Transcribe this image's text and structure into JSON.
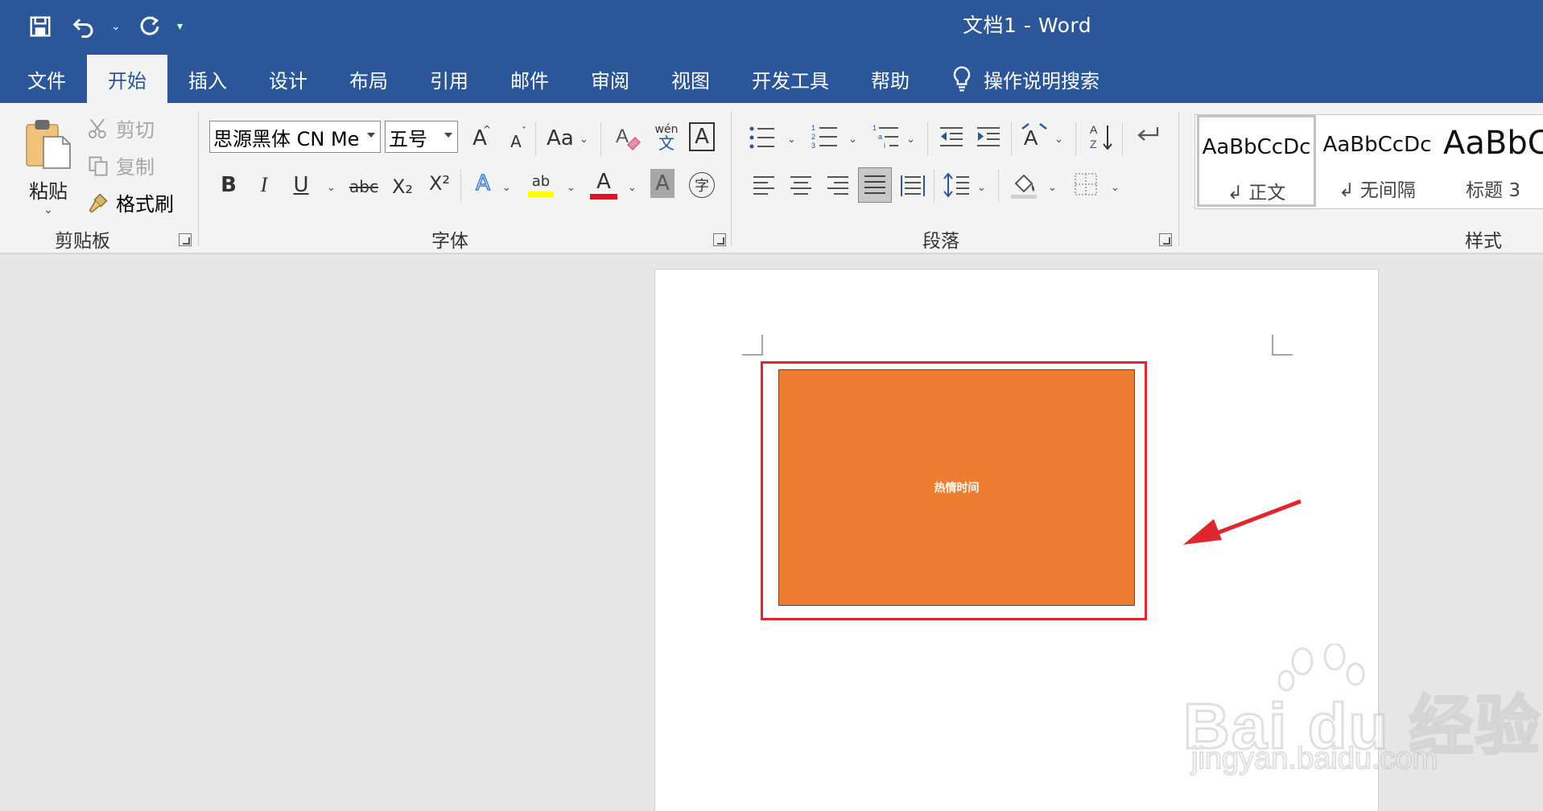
{
  "window": {
    "title": "文档1  -  Word"
  },
  "quick_access": {
    "icons": [
      "save-icon",
      "undo-icon",
      "redo-icon",
      "customize-icon"
    ]
  },
  "tabs": [
    {
      "label": "文件"
    },
    {
      "label": "开始",
      "active": true
    },
    {
      "label": "插入"
    },
    {
      "label": "设计"
    },
    {
      "label": "布局"
    },
    {
      "label": "引用"
    },
    {
      "label": "邮件"
    },
    {
      "label": "审阅"
    },
    {
      "label": "视图"
    },
    {
      "label": "开发工具"
    },
    {
      "label": "帮助"
    }
  ],
  "tell_me": {
    "label": "操作说明搜索"
  },
  "clipboard": {
    "paste_label": "粘贴",
    "cut_label": "剪切",
    "copy_label": "复制",
    "format_painter_label": "格式刷",
    "group_label": "剪贴板"
  },
  "font": {
    "font_name": "思源黑体 CN Me",
    "font_size": "五号",
    "case_label": "Aa",
    "group_label": "字体",
    "grow_label": "A",
    "shrink_label": "A",
    "bold": "B",
    "italic": "I",
    "underline": "U",
    "strike": "abc",
    "subscript": "X₂",
    "superscript": "X²",
    "text_effect": "A",
    "highlight": "ab",
    "font_color": "A",
    "shading": "A",
    "enclose": "字",
    "phonetic_top": "wén",
    "phonetic_bottom": "文",
    "border": "A"
  },
  "paragraph": {
    "group_label": "段落"
  },
  "styles": {
    "group_label": "样式",
    "items": [
      {
        "sample": "AaBbCcDc",
        "name": "↲ 正文",
        "selected": true
      },
      {
        "sample": "AaBbCcDc",
        "name": "↲ 无间隔"
      },
      {
        "sample": "AaBbC",
        "name": "标题 3"
      }
    ]
  },
  "document": {
    "shape_text": "热情时间",
    "shape_color": "#ed7d31",
    "highlight_color": "#e0272d"
  },
  "watermark": {
    "main": "Bai du 经验",
    "sub": "jingyan.baidu.com"
  },
  "colors": {
    "titlebar": "#2b579a",
    "ribbon": "#f3f3f3",
    "canvas": "#e6e6e6"
  }
}
